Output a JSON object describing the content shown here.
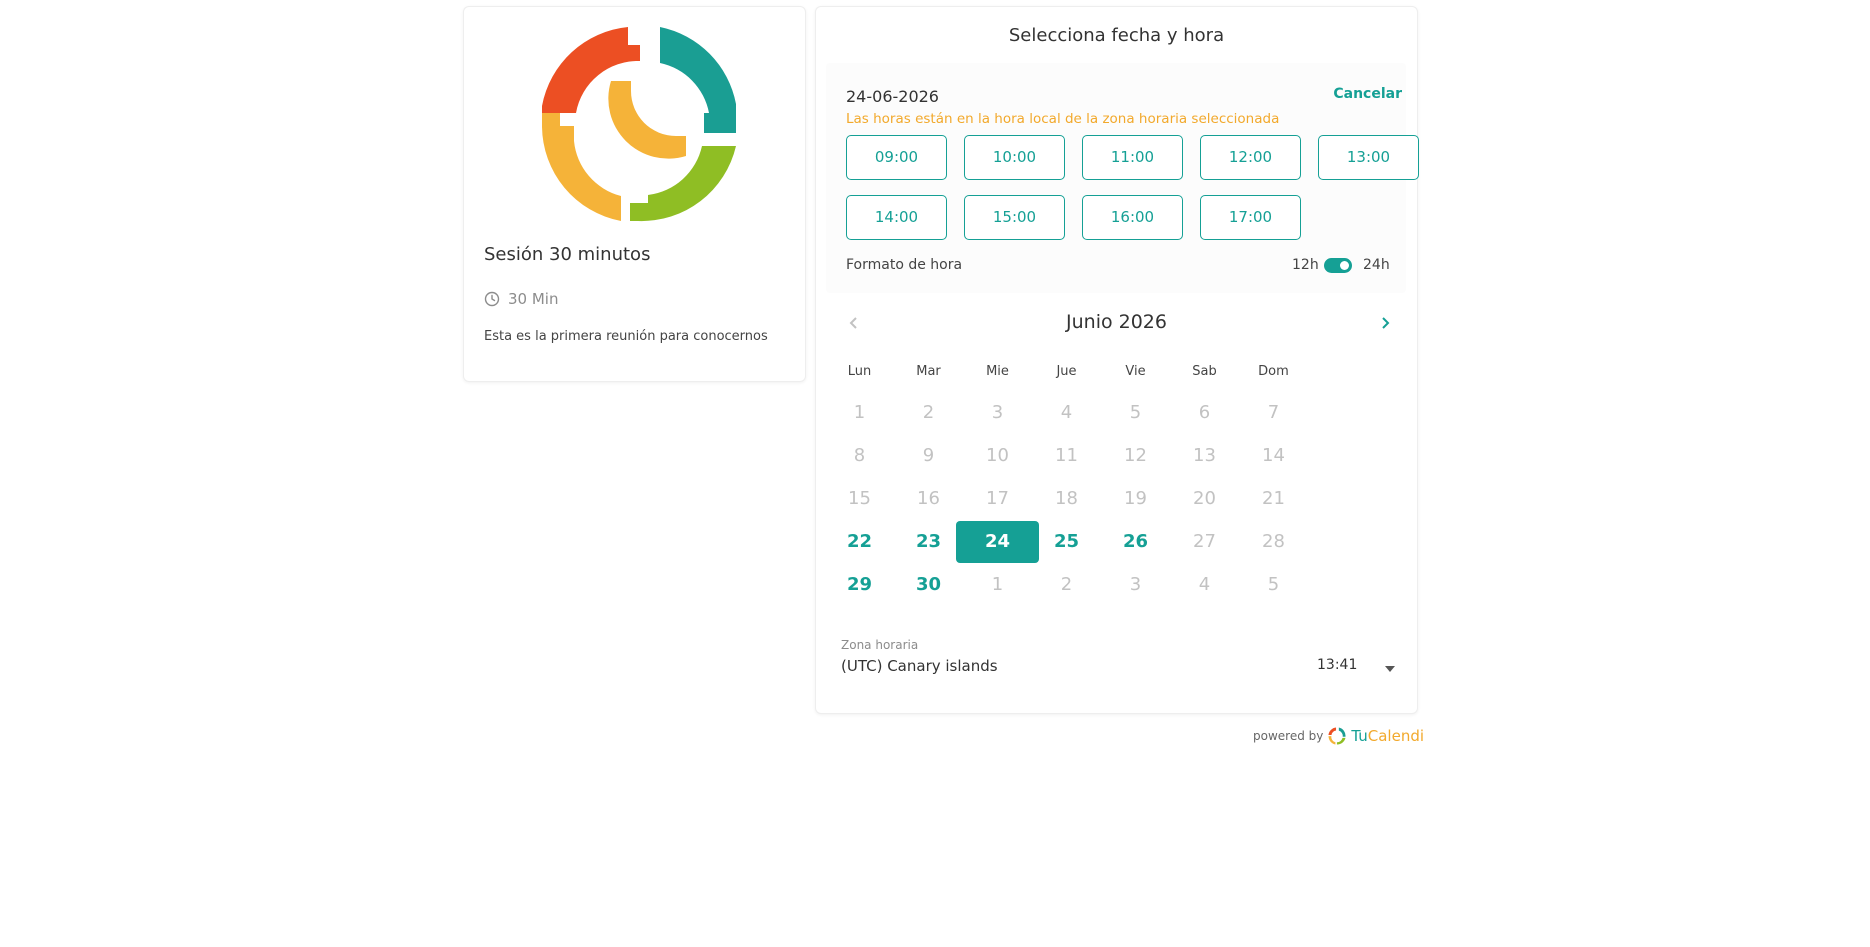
{
  "event": {
    "title": "Sesión 30 minutos",
    "duration": "30 Min",
    "description": "Esta es la primera reunión para conocernos"
  },
  "booking": {
    "heading": "Selecciona fecha y hora",
    "selected_date": "24-06-2026",
    "cancel_label": "Cancelar",
    "timezone_note": "Las horas están en la hora local de la zona horaria seleccionada",
    "slots": [
      "09:00",
      "10:00",
      "11:00",
      "12:00",
      "13:00",
      "14:00",
      "15:00",
      "16:00",
      "17:00"
    ],
    "time_format": {
      "label": "Formato de hora",
      "option_12": "12h",
      "option_24": "24h",
      "selected": "24h"
    }
  },
  "calendar": {
    "month_label": "Junio 2026",
    "weekdays": [
      "Lun",
      "Mar",
      "Mie",
      "Jue",
      "Vie",
      "Sab",
      "Dom"
    ],
    "weeks": [
      [
        "1",
        "2",
        "3",
        "4",
        "5",
        "6",
        "7"
      ],
      [
        "8",
        "9",
        "10",
        "11",
        "12",
        "13",
        "14"
      ],
      [
        "15",
        "16",
        "17",
        "18",
        "19",
        "20",
        "21"
      ],
      [
        "22",
        "23",
        "24",
        "25",
        "26",
        "27",
        "28"
      ],
      [
        "29",
        "30",
        "1",
        "2",
        "3",
        "4",
        "5"
      ]
    ],
    "available_days": [
      "22",
      "23",
      "25",
      "26",
      "29",
      "30"
    ],
    "selected_day": "24"
  },
  "timezone": {
    "label": "Zona horaria",
    "value": "(UTC) Canary islands",
    "current_time": "13:41"
  },
  "footer": {
    "powered_by": "powered by",
    "brand_part1": "Tu",
    "brand_part2": "Calendi"
  },
  "colors": {
    "accent": "#15a095",
    "warning": "#f2a92c",
    "logo_red": "#ec4f23",
    "logo_teal": "#1a9e93",
    "logo_yellow": "#f5b339",
    "logo_green": "#8fbe24"
  }
}
